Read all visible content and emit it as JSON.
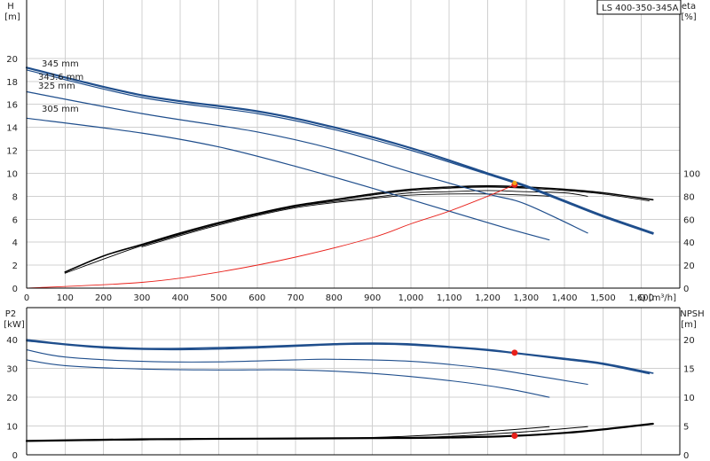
{
  "title": "LS 400-350-345A",
  "colors": {
    "curve": "#1f4e8c",
    "system": "#e8201a",
    "efficiency": "#000000",
    "duty_point": "#e8201a",
    "duty_point_top": "#f2a51a",
    "grid": "#d0d0d0"
  },
  "chart_data": [
    {
      "type": "line",
      "name": "head-efficiency",
      "x_label": "Q [m³/h]",
      "x_ticks": [
        0,
        100,
        200,
        300,
        400,
        500,
        600,
        700,
        800,
        900,
        1000,
        1100,
        1200,
        1300,
        1400,
        1500,
        1600
      ],
      "x_tick_labels": [
        "0",
        "100",
        "200",
        "300",
        "400",
        "500",
        "600",
        "700",
        "800",
        "900",
        "1,000",
        "1,100",
        "1,200",
        "1,300",
        "1,400",
        "1,500",
        "1,600"
      ],
      "xlim": [
        0,
        1700
      ],
      "left_axis": {
        "label_top": "H",
        "label_unit": "[m]",
        "lim": [
          0,
          22
        ],
        "ticks": [
          0,
          2,
          4,
          6,
          8,
          10,
          12,
          14,
          16,
          18,
          20
        ]
      },
      "right_axis": {
        "label_top": "eta",
        "label_unit": "[%]",
        "lim": [
          0,
          220
        ],
        "ticks": [
          0,
          20,
          40,
          60,
          80,
          100
        ]
      },
      "head_curves": [
        {
          "name": "345 mm",
          "points": [
            [
              0,
              19.2
            ],
            [
              300,
              16.8
            ],
            [
              600,
              15.4
            ],
            [
              800,
              14.0
            ],
            [
              1000,
              12.2
            ],
            [
              1200,
              10.0
            ],
            [
              1300,
              8.9
            ],
            [
              1400,
              7.6
            ],
            [
              1500,
              6.3
            ],
            [
              1630,
              4.8
            ]
          ]
        },
        {
          "name": "343.6 mm",
          "points": [
            [
              0,
              19.0
            ],
            [
              300,
              16.6
            ],
            [
              600,
              15.2
            ],
            [
              800,
              13.8
            ],
            [
              1000,
              12.0
            ],
            [
              1200,
              9.9
            ],
            [
              1300,
              8.8
            ],
            [
              1400,
              7.5
            ],
            [
              1500,
              6.2
            ],
            [
              1630,
              4.7
            ]
          ]
        },
        {
          "name": "325 mm",
          "points": [
            [
              0,
              17.1
            ],
            [
              300,
              15.2
            ],
            [
              600,
              13.6
            ],
            [
              800,
              12.1
            ],
            [
              1000,
              10.1
            ],
            [
              1200,
              8.2
            ],
            [
              1300,
              7.3
            ],
            [
              1460,
              4.8
            ]
          ]
        },
        {
          "name": "305 mm",
          "points": [
            [
              0,
              14.8
            ],
            [
              300,
              13.5
            ],
            [
              500,
              12.3
            ],
            [
              700,
              10.6
            ],
            [
              900,
              8.7
            ],
            [
              1100,
              6.7
            ],
            [
              1250,
              5.2
            ],
            [
              1360,
              4.2
            ]
          ]
        }
      ],
      "system_curve": [
        [
          0,
          0
        ],
        [
          300,
          0.5
        ],
        [
          500,
          1.4
        ],
        [
          700,
          2.7
        ],
        [
          900,
          4.4
        ],
        [
          1000,
          5.6
        ],
        [
          1100,
          6.7
        ],
        [
          1200,
          8.0
        ],
        [
          1270,
          9.0
        ]
      ],
      "efficiency_curves": [
        {
          "name": "345 mm",
          "points": [
            [
              100,
              14
            ],
            [
              200,
              28
            ],
            [
              300,
              38
            ],
            [
              400,
              48
            ],
            [
              500,
              57
            ],
            [
              600,
              65
            ],
            [
              700,
              72
            ],
            [
              800,
              77
            ],
            [
              900,
              82
            ],
            [
              1000,
              86
            ],
            [
              1100,
              88
            ],
            [
              1200,
              89
            ],
            [
              1300,
              88
            ],
            [
              1400,
              86
            ],
            [
              1500,
              83
            ],
            [
              1630,
              77
            ]
          ]
        },
        {
          "name": "343.6 mm",
          "points": [
            [
              100,
              13
            ],
            [
              300,
              37
            ],
            [
              500,
              56
            ],
            [
              700,
              71
            ],
            [
              900,
              81
            ],
            [
              1000,
              85
            ],
            [
              1100,
              87
            ],
            [
              1200,
              88
            ],
            [
              1300,
              87
            ],
            [
              1400,
              85
            ],
            [
              1500,
              82
            ],
            [
              1620,
              76
            ]
          ]
        },
        {
          "name": "325 mm",
          "points": [
            [
              300,
              37
            ],
            [
              500,
              56
            ],
            [
              700,
              71
            ],
            [
              900,
              79
            ],
            [
              1000,
              83
            ],
            [
              1100,
              84
            ],
            [
              1200,
              85
            ],
            [
              1300,
              84
            ],
            [
              1400,
              83
            ],
            [
              1460,
              80
            ]
          ]
        },
        {
          "name": "305 mm",
          "points": [
            [
              300,
              36
            ],
            [
              500,
              55
            ],
            [
              700,
              70
            ],
            [
              900,
              78
            ],
            [
              1000,
              81
            ],
            [
              1100,
              82
            ],
            [
              1200,
              82
            ],
            [
              1300,
              81
            ],
            [
              1360,
              80
            ]
          ]
        }
      ],
      "duty_point": {
        "q": 1270,
        "h": 9.0,
        "eta": 89
      }
    },
    {
      "type": "line",
      "name": "power-npsh",
      "left_axis": {
        "label_top": "P2",
        "label_unit": "[kW]",
        "lim": [
          0,
          45
        ],
        "ticks": [
          0,
          10,
          20,
          30,
          40
        ]
      },
      "right_axis": {
        "label_top": "NPSH",
        "label_unit": "[m]",
        "lim": [
          0,
          22.5
        ],
        "ticks": [
          0,
          5,
          10,
          15,
          20
        ]
      },
      "power_curves": [
        {
          "name": "345 mm",
          "points": [
            [
              0,
              40.0
            ],
            [
              100,
              38.5
            ],
            [
              200,
              37.5
            ],
            [
              300,
              37.0
            ],
            [
              400,
              37.0
            ],
            [
              600,
              37.6
            ],
            [
              800,
              38.6
            ],
            [
              900,
              38.8
            ],
            [
              1000,
              38.5
            ],
            [
              1100,
              37.6
            ],
            [
              1200,
              36.6
            ],
            [
              1300,
              35.0
            ],
            [
              1400,
              33.5
            ],
            [
              1500,
              31.8
            ],
            [
              1630,
              28.4
            ]
          ]
        },
        {
          "name": "343.6 mm",
          "points": [
            [
              0,
              39.6
            ],
            [
              200,
              37.2
            ],
            [
              400,
              36.6
            ],
            [
              600,
              37.2
            ],
            [
              800,
              38.3
            ],
            [
              900,
              38.5
            ],
            [
              1000,
              38.2
            ],
            [
              1200,
              36.3
            ],
            [
              1400,
              33.2
            ],
            [
              1500,
              31.5
            ],
            [
              1620,
              28.2
            ]
          ]
        },
        {
          "name": "325 mm",
          "points": [
            [
              0,
              36.5
            ],
            [
              100,
              34.0
            ],
            [
              300,
              32.5
            ],
            [
              500,
              32.3
            ],
            [
              700,
              33.0
            ],
            [
              800,
              33.2
            ],
            [
              1000,
              32.5
            ],
            [
              1200,
              30.0
            ],
            [
              1300,
              28.0
            ],
            [
              1460,
              24.5
            ]
          ]
        },
        {
          "name": "305 mm",
          "points": [
            [
              0,
              33.0
            ],
            [
              100,
              31.0
            ],
            [
              300,
              29.8
            ],
            [
              500,
              29.5
            ],
            [
              700,
              29.5
            ],
            [
              900,
              28.3
            ],
            [
              1100,
              25.8
            ],
            [
              1250,
              23.0
            ],
            [
              1360,
              20.0
            ]
          ]
        }
      ],
      "npsh_curves": [
        {
          "name": "345 mm",
          "points": [
            [
              0,
              2.4
            ],
            [
              300,
              2.7
            ],
            [
              600,
              2.8
            ],
            [
              900,
              2.9
            ],
            [
              1100,
              3.0
            ],
            [
              1270,
              3.3
            ],
            [
              1400,
              3.8
            ],
            [
              1500,
              4.4
            ],
            [
              1630,
              5.4
            ]
          ]
        },
        {
          "name": "343.6 mm",
          "points": [
            [
              0,
              2.4
            ],
            [
              600,
              2.8
            ],
            [
              900,
              2.9
            ],
            [
              1100,
              3.0
            ],
            [
              1300,
              3.4
            ],
            [
              1450,
              4.1
            ],
            [
              1620,
              5.3
            ]
          ]
        },
        {
          "name": "325 mm",
          "points": [
            [
              0,
              2.4
            ],
            [
              600,
              2.8
            ],
            [
              900,
              2.9
            ],
            [
              1100,
              3.2
            ],
            [
              1300,
              4.0
            ],
            [
              1460,
              4.9
            ]
          ]
        },
        {
          "name": "305 mm",
          "points": [
            [
              0,
              2.4
            ],
            [
              600,
              2.8
            ],
            [
              900,
              3.0
            ],
            [
              1100,
              3.6
            ],
            [
              1250,
              4.3
            ],
            [
              1360,
              4.9
            ]
          ]
        }
      ],
      "duty_point": {
        "q": 1270,
        "p2": 35.5,
        "npsh": 3.3
      }
    }
  ]
}
